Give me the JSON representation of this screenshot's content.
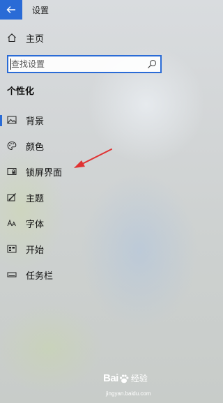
{
  "window": {
    "title": "设置"
  },
  "home": {
    "label": "主页",
    "icon": "home-icon"
  },
  "search": {
    "placeholder": "查找设置",
    "value": ""
  },
  "section": {
    "title": "个性化"
  },
  "nav": {
    "items": [
      {
        "label": "背景",
        "icon": "picture-icon",
        "selected": true
      },
      {
        "label": "颜色",
        "icon": "palette-icon",
        "selected": false
      },
      {
        "label": "锁屏界面",
        "icon": "lock-screen-icon",
        "selected": false
      },
      {
        "label": "主题",
        "icon": "theme-brush-icon",
        "selected": false
      },
      {
        "label": "字体",
        "icon": "font-icon",
        "selected": false
      },
      {
        "label": "开始",
        "icon": "start-menu-icon",
        "selected": false
      },
      {
        "label": "任务栏",
        "icon": "taskbar-icon",
        "selected": false
      }
    ]
  },
  "colors": {
    "accent": "#2a6bd6",
    "annotation": "#e03232"
  },
  "watermark": {
    "brand": "Bai",
    "brand_cn": "经验",
    "site": "jingyan.baidu.com"
  }
}
